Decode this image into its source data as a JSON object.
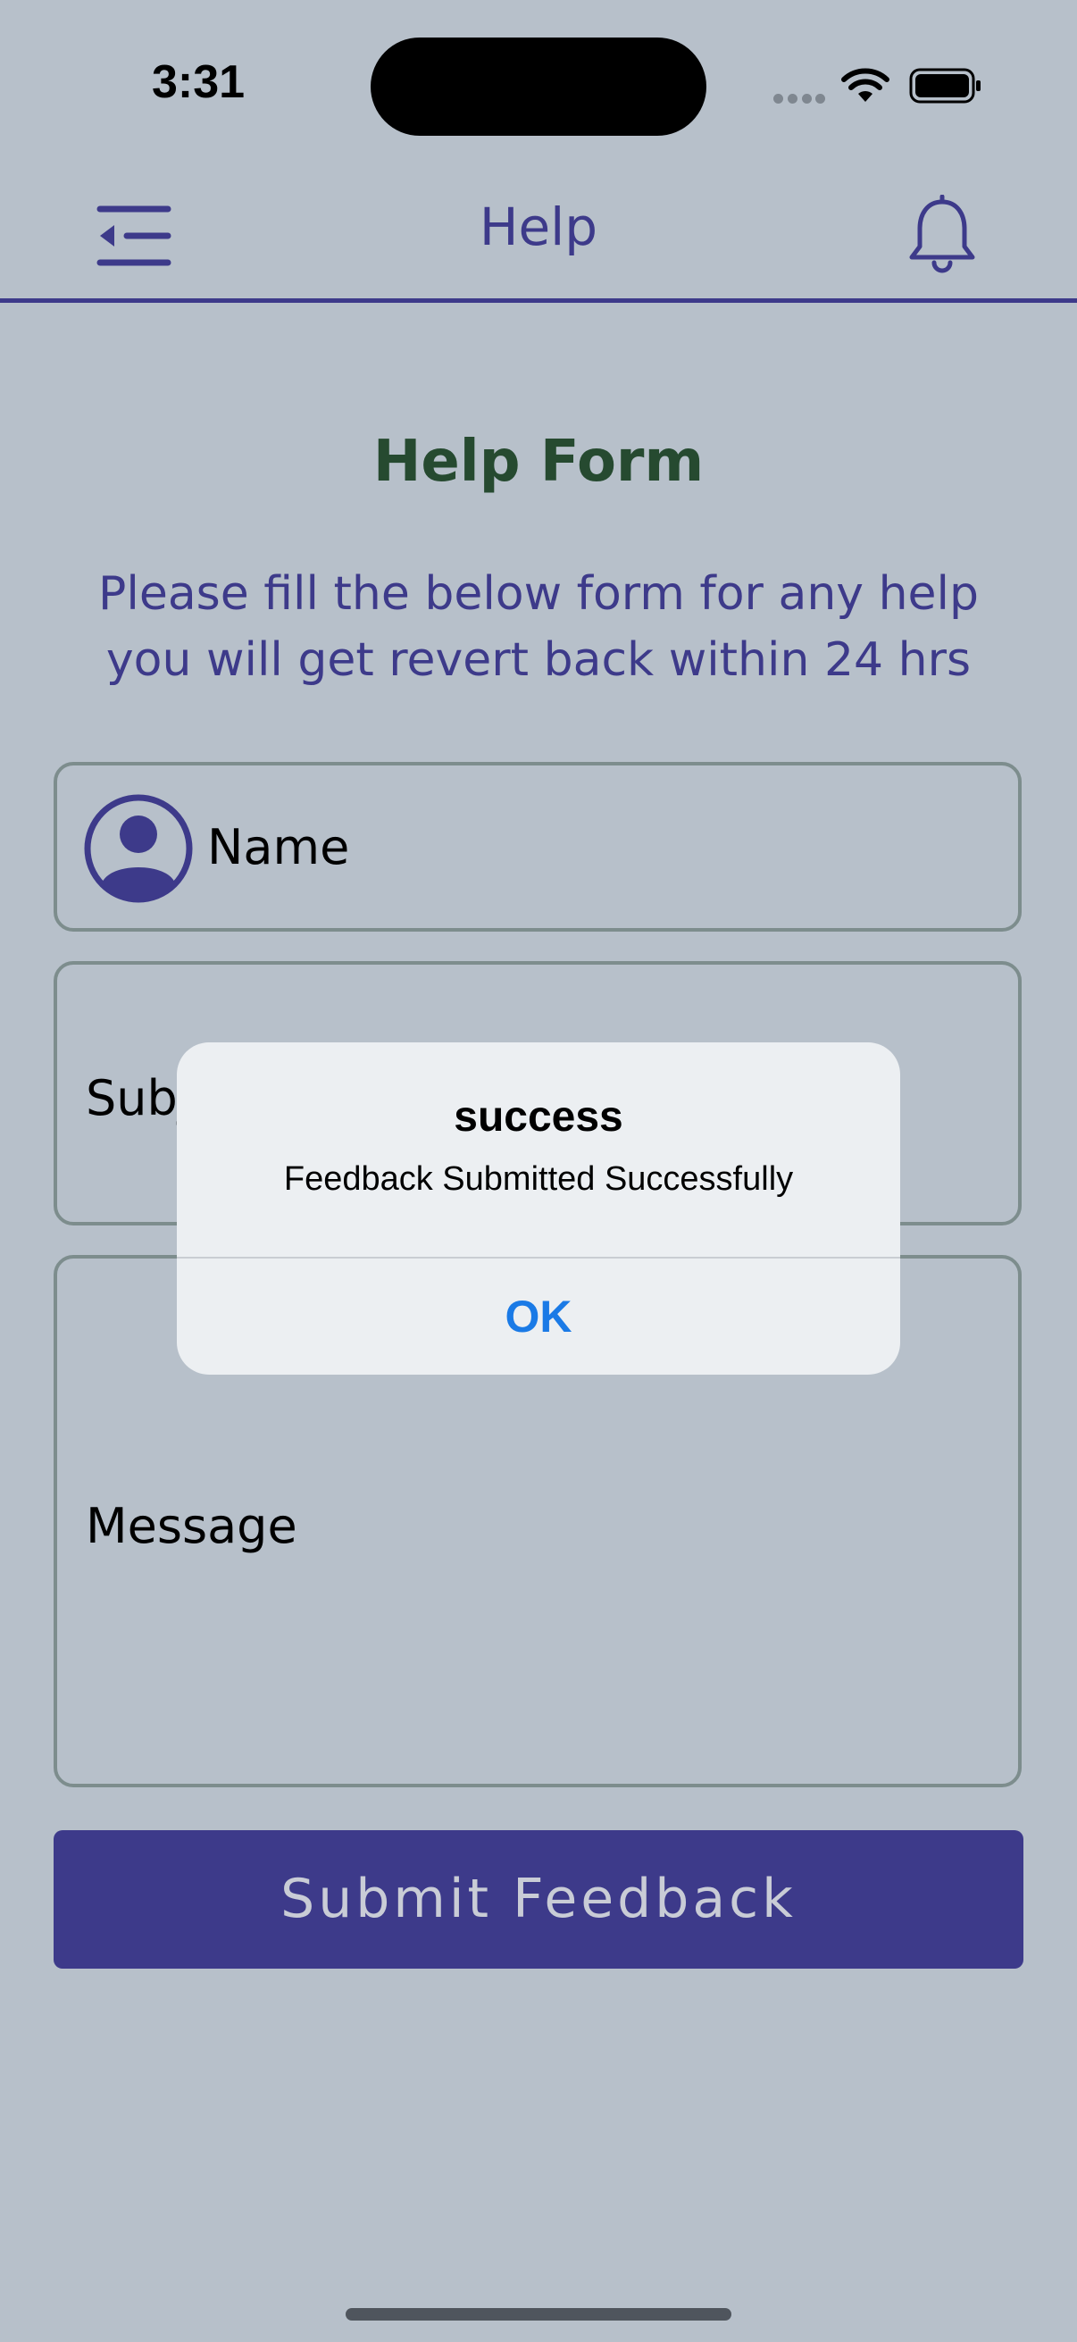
{
  "status_bar": {
    "time": "3:31",
    "icons": [
      "cellular-icon",
      "wifi-icon",
      "battery-icon"
    ]
  },
  "header": {
    "title": "Help",
    "left_icon": "menu-icon",
    "right_icon": "bell-icon",
    "accent_color": "#3d3a8a"
  },
  "form": {
    "title": "Help Form",
    "subtitle_line1": "Please fill the below form for any help",
    "subtitle_line2": "you will get revert back within 24 hrs",
    "name_placeholder": "Name",
    "subject_placeholder": "Subj",
    "message_placeholder": "Message",
    "submit_label": "Submit Feedback"
  },
  "alert": {
    "title": "success",
    "message": "Feedback Submitted Successfully",
    "ok_label": "OK",
    "ok_color": "#1a7ae6"
  },
  "colors": {
    "background": "#b7c0ca",
    "title_green": "#264a30",
    "field_border": "#7d8d8d"
  }
}
